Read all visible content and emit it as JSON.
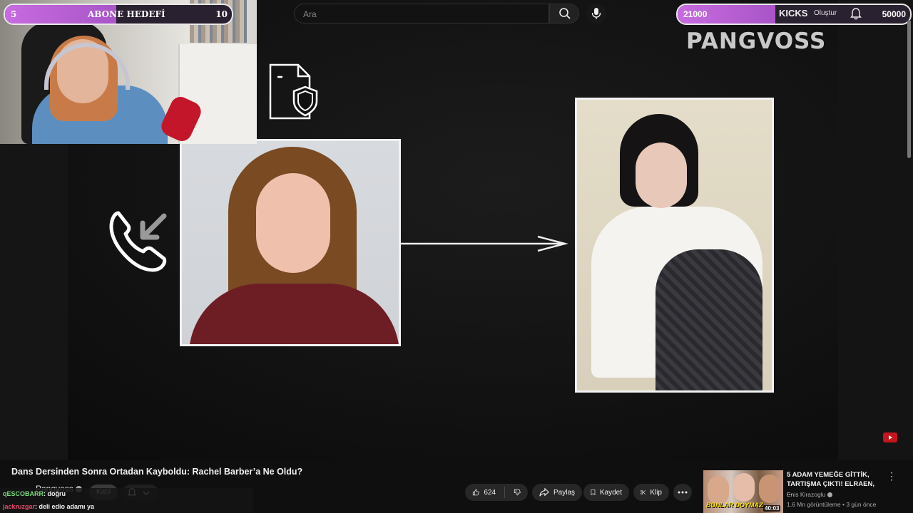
{
  "overlay": {
    "subscriber_goal": {
      "start": "5",
      "label": "ABONE HEDEFİ",
      "end": "10",
      "progress": 0.49
    },
    "donation_goal": {
      "current": "21000",
      "target": "50000",
      "progress": 0.42
    },
    "brand_watermark": "PANGVOSS",
    "chat": [
      {
        "user": "qESCOBARR",
        "message": ": doğru"
      },
      {
        "user": "jackruzgar",
        "message": ": deli edio adamı ya"
      }
    ]
  },
  "header": {
    "search_placeholder": "Ara",
    "kicks_label": "KICKS",
    "create_label": "Oluştur",
    "icons": [
      "search-icon",
      "mic-icon",
      "bell-icon"
    ]
  },
  "video": {
    "title": "Dans Dersinden Sonra Ortadan Kayboldu: Rachel Barber’a Ne Oldu?",
    "channel": "Pangvoss",
    "join_label": "Katıl",
    "like_count": "624",
    "share_label": "Paylaş",
    "save_label": "Kaydet",
    "clip_label": "Klip"
  },
  "recommended": {
    "title": "5 ADAM YEMEĞE GİTTİK, TARTIŞMA ÇIKTI! ELRAEN, ...",
    "channel": "Enis Kirazoglu",
    "views": "1,6 Mn görüntüleme",
    "age": "3 gün önce",
    "duration": "40:03",
    "thumb_caption": "BUNLAR DOYMAZ"
  },
  "colors": {
    "goal_fill": "#c86be0",
    "chat_user1": "#7cd87c",
    "chat_user2": "#e34a6a",
    "background": "#0f0f0f"
  }
}
